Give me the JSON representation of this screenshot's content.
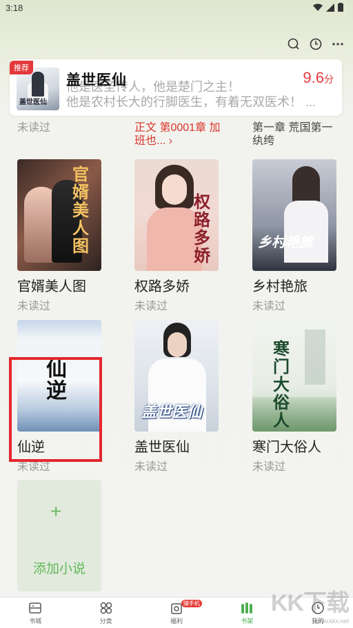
{
  "status_bar": {
    "time": "3:18"
  },
  "recommend": {
    "badge": "推荐",
    "cover_label": "盖世医仙",
    "title": "盖世医仙",
    "desc_line1": "他是医圣传人，他是楚门之主！",
    "desc_line2": "他是农村长大的行脚医生，有着无双医术！ ...",
    "score": "9.6",
    "score_unit": "分"
  },
  "prev_row": {
    "col1": "未读过",
    "col2": "正文 第0001章 加班也... ›",
    "col3": "第一章 荒国第一纨绔"
  },
  "books": [
    {
      "title": "官婿美人图",
      "status": "未读过",
      "cover_text": "官婿美人图"
    },
    {
      "title": "权路多娇",
      "status": "未读过",
      "cover_text": "权路多娇"
    },
    {
      "title": "乡村艳旅",
      "status": "未读过",
      "cover_text": "乡村艳旅"
    },
    {
      "title": "仙逆",
      "status": "未读过",
      "cover_text": "仙逆"
    },
    {
      "title": "盖世医仙",
      "status": "未读过",
      "cover_text": "盖世医仙"
    },
    {
      "title": "寒门大俗人",
      "status": "未读过",
      "cover_text": "寒门大俗人"
    }
  ],
  "add_tile": {
    "plus": "+",
    "label": "添加小说"
  },
  "bottom_nav": [
    {
      "label": "书城",
      "icon": "bookstore-icon"
    },
    {
      "label": "分类",
      "icon": "category-icon"
    },
    {
      "label": "福利",
      "icon": "gift-icon",
      "badge": "赚手机"
    },
    {
      "label": "书架",
      "icon": "bookshelf-icon",
      "active": true
    },
    {
      "label": "我的",
      "icon": "profile-icon"
    }
  ],
  "watermark": {
    "big": "KK下载",
    "small": "www.kkx.net"
  },
  "colors": {
    "accent": "#4caf50",
    "red": "#e4393c"
  }
}
